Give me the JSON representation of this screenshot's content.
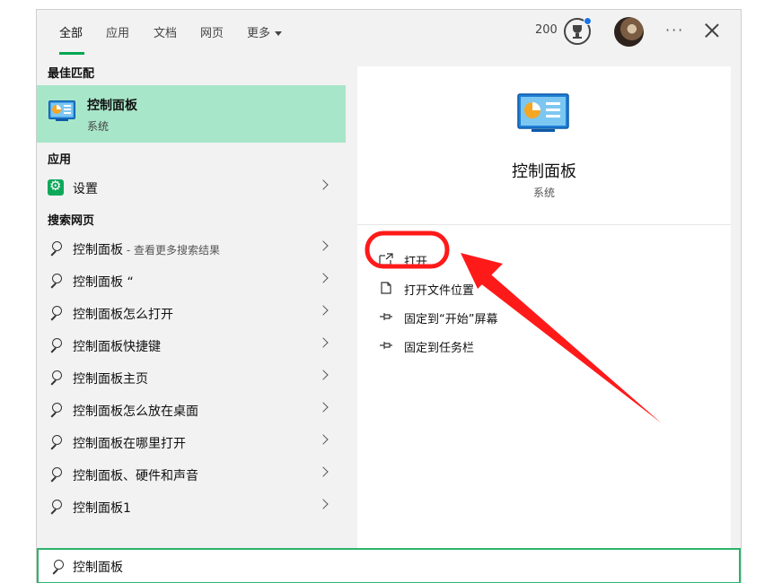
{
  "tabs": [
    {
      "label": "全部",
      "active": true
    },
    {
      "label": "应用"
    },
    {
      "label": "文档"
    },
    {
      "label": "网页"
    },
    {
      "label": "更多"
    }
  ],
  "header": {
    "points": "200",
    "trophy_icon": "trophy-icon",
    "avatar": "user-avatar"
  },
  "sections": {
    "best_match": "最佳匹配",
    "apps": "应用",
    "web": "搜索网页"
  },
  "best_match": {
    "title": "控制面板",
    "subtitle": "系统",
    "icon": "control-panel-icon"
  },
  "apps": [
    {
      "label": "设置",
      "icon": "settings-gear-icon"
    }
  ],
  "web_results": [
    {
      "label": "控制面板",
      "suffix": " - 查看更多搜索结果"
    },
    {
      "label": "控制面板 “",
      "suffix": ""
    },
    {
      "label": "控制面板怎么打开",
      "suffix": ""
    },
    {
      "label": "控制面板快捷键",
      "suffix": ""
    },
    {
      "label": "控制面板主页",
      "suffix": ""
    },
    {
      "label": "控制面板怎么放在桌面",
      "suffix": ""
    },
    {
      "label": "控制面板在哪里打开",
      "suffix": ""
    },
    {
      "label": "控制面板、硬件和声音",
      "suffix": ""
    },
    {
      "label": "控制面板1",
      "suffix": ""
    }
  ],
  "preview": {
    "title": "控制面板",
    "subtitle": "系统",
    "actions": [
      {
        "label": "打开",
        "icon": "open-icon"
      },
      {
        "label": "打开文件位置",
        "icon": "file-location-icon"
      },
      {
        "label": "固定到“开始”屏幕",
        "icon": "pin-icon"
      },
      {
        "label": "固定到任务栏",
        "icon": "pin-icon"
      }
    ]
  },
  "search": {
    "value": "控制面板"
  },
  "colors": {
    "accent": "#00a651",
    "highlight": "#a8e6c9",
    "annotation": "#ff1a1a",
    "badge": "#1a73e8"
  }
}
